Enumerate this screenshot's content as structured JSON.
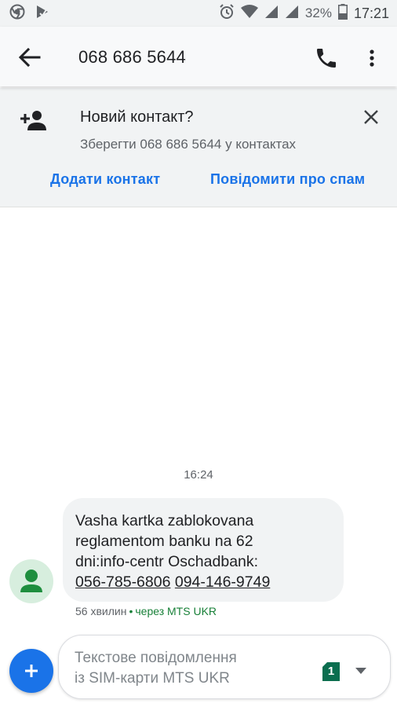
{
  "status_bar": {
    "battery_percent": "32%",
    "time": "17:21"
  },
  "app_bar": {
    "title": "068 686 5644",
    "icons": [
      "back-arrow-icon",
      "phone-call-icon",
      "more-vert-icon"
    ]
  },
  "banner": {
    "title": "Новий контакт?",
    "subtitle": "Зберегти 068 686 5644 у контактах",
    "add_contact_label": "Додати контакт",
    "report_spam_label": "Повідомити про спам"
  },
  "conversation": {
    "timestamp": "16:24",
    "message": {
      "line1": "Vasha kartka zablokovana",
      "line2": "reglamentom banku na 62",
      "line3": "dni:info-centr Oschadbank:",
      "phone1": "056-785-6806",
      "phone2": "094-146-9749"
    },
    "meta": {
      "age": "56 хвилин",
      "separator": "•",
      "via": "через MTS UKR"
    }
  },
  "composer": {
    "placeholder_line1": "Текстове повідомлення",
    "placeholder_line2": "із SIM-карти MTS UKR",
    "sim_number": "1"
  },
  "colors": {
    "accent": "#1a73e8",
    "sim_badge": "#0b6e4f",
    "avatar_bg": "#d7eede",
    "avatar_fg": "#1e8e3e",
    "meta_green": "#188038"
  }
}
